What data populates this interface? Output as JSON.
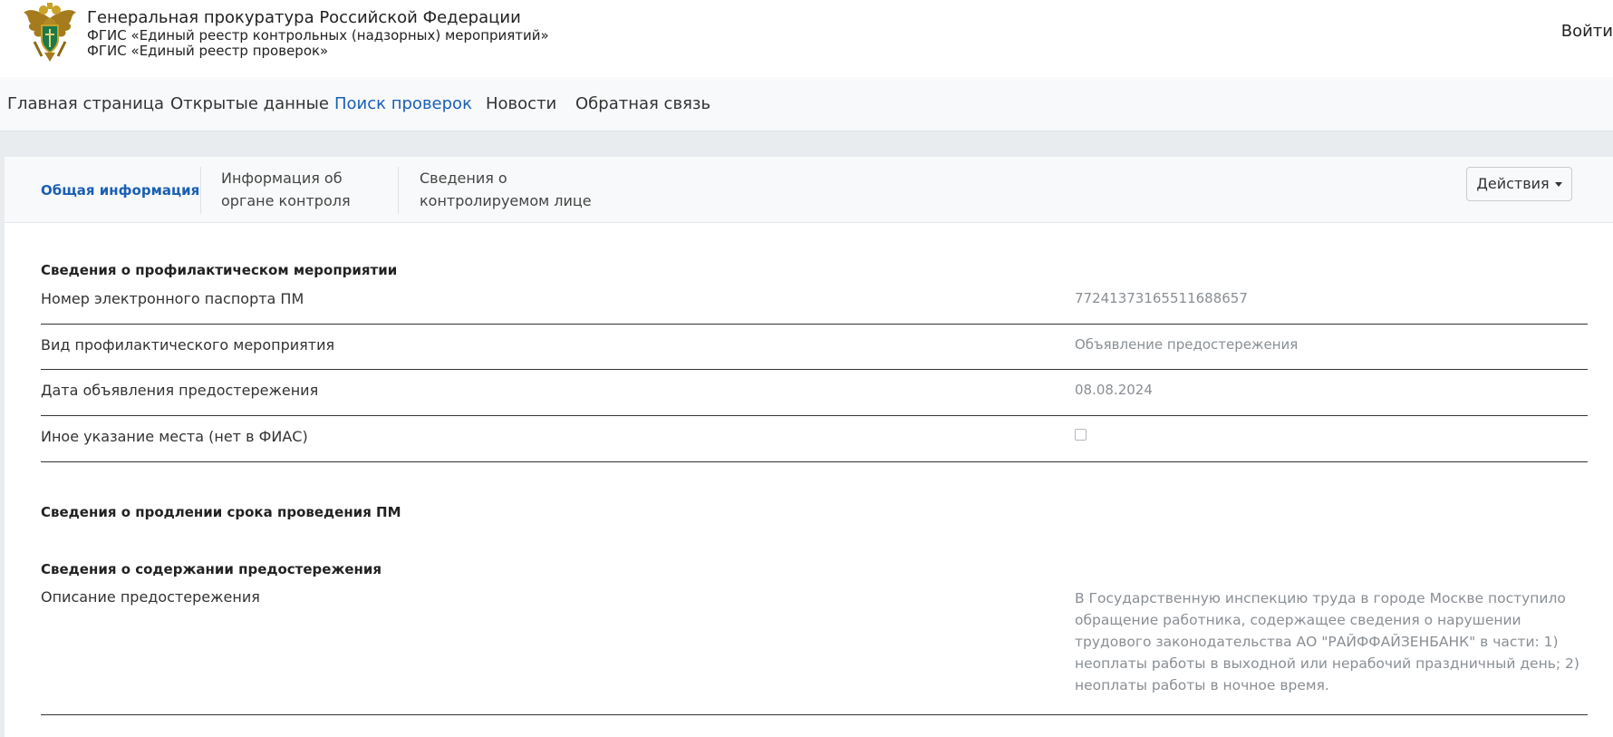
{
  "header": {
    "org_name": "Генеральная прокуратура Российской Федерации",
    "system_name_1": "ФГИС «Единый реестр контрольных (надзорных) мероприятий»",
    "system_name_2": "ФГИС «Единый реестр проверок»",
    "login_label": "Войти"
  },
  "nav": {
    "items": [
      {
        "label": "Главная страница"
      },
      {
        "label": "Открытые данные"
      },
      {
        "label": "Поиск проверок"
      },
      {
        "label": "Новости"
      },
      {
        "label": "Обратная связь"
      }
    ],
    "active_index": 2
  },
  "tabs": {
    "items": [
      {
        "line1": "Общая информация",
        "line2": ""
      },
      {
        "line1": "Информация об",
        "line2": "органе контроля"
      },
      {
        "line1": "Сведения о",
        "line2": "контролируемом лице"
      }
    ],
    "active_index": 0,
    "actions_label": "Действия"
  },
  "sections": {
    "prevention": {
      "title": "Сведения о профилактическом мероприятии",
      "rows": [
        {
          "label": "Номер электронного паспорта ПМ",
          "value": "77241373165511688657"
        },
        {
          "label": "Вид профилактического мероприятия",
          "value": "Объявление предостережения"
        },
        {
          "label": "Дата объявления предостережения",
          "value": "08.08.2024"
        },
        {
          "label": "Иное указание места (нет в ФИАС)",
          "value": ""
        }
      ],
      "fias_checkbox_checked": false
    },
    "extension": {
      "title": "Сведения о продлении срока проведения ПМ"
    },
    "content": {
      "title": "Сведения о содержании предостережения",
      "description_label": "Описание предостережения",
      "description_value": "В Государственную инспекцию труда в городе Москве поступило обращение работника, содержащее сведения о нарушении трудового законодательства АО \"РАЙФФАЙЗЕНБАНК\" в части: 1) неоплаты работы в выходной или нерабочий праздничный день; 2) неоплаты работы в ночное время."
    }
  },
  "colors": {
    "accent": "#1a5fb4",
    "muted_value": "#8a8f94",
    "background": "#e9ecef"
  }
}
